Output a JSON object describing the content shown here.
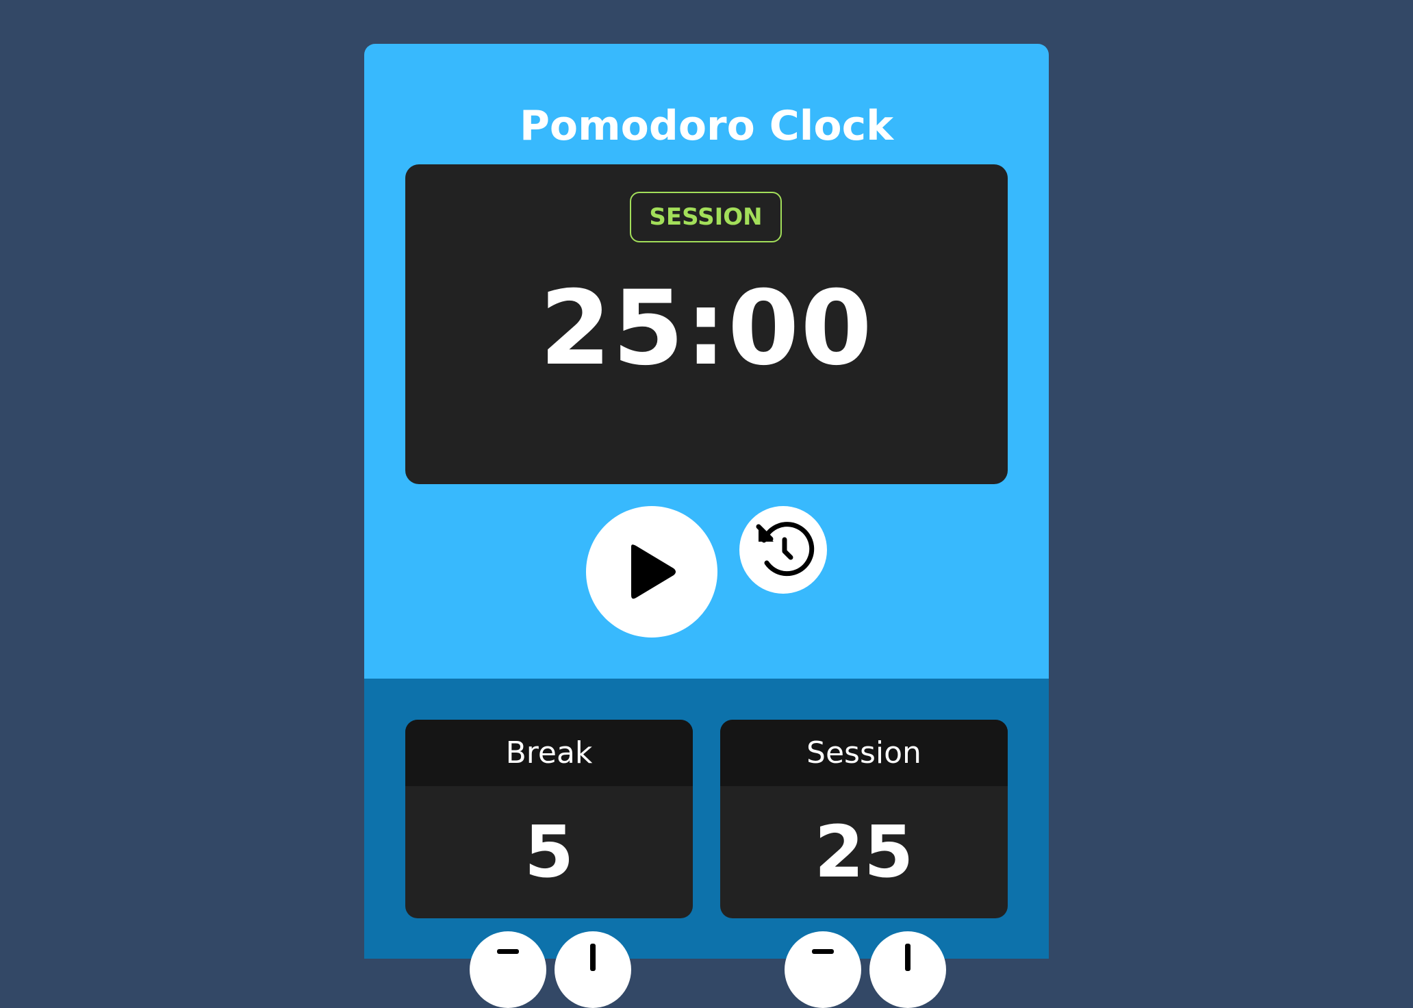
{
  "app": {
    "title": "Pomodoro Clock"
  },
  "timer": {
    "mode_label": "SESSION",
    "time": "25:00"
  },
  "controls": {
    "play_icon": "play-icon",
    "reset_icon": "history-reset-icon"
  },
  "settings": {
    "break": {
      "label": "Break",
      "value": "5"
    },
    "session": {
      "label": "Session",
      "value": "25"
    }
  },
  "colors": {
    "page_background": "#334866",
    "app_background": "#38b9fd",
    "settings_background": "#0d72ab",
    "display_background": "#222222",
    "card_header_background": "#151515",
    "mode_accent": "#a3df5a",
    "text": "#ffffff"
  }
}
